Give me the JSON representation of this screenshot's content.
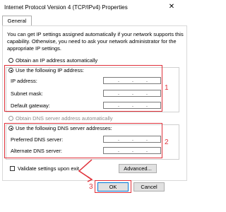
{
  "window": {
    "title": "Internet Protocol Version 4 (TCP/IPv4) Properties",
    "close_glyph": "✕"
  },
  "tabs": [
    {
      "label": "General"
    }
  ],
  "description": "You can get IP settings assigned automatically if your network supports this capability. Otherwise, you need to ask your network administrator for the appropriate IP settings.",
  "ip": {
    "auto_label": "Obtain an IP address automatically",
    "manual_label": "Use the following IP address:",
    "fields": [
      {
        "label": "IP address:"
      },
      {
        "label": "Subnet mask:"
      },
      {
        "label": "Default gateway:"
      }
    ]
  },
  "dns": {
    "auto_label": "Obtain DNS server address automatically",
    "manual_label": "Use the following DNS server addresses:",
    "fields": [
      {
        "label": "Preferred DNS server:"
      },
      {
        "label": "Alternate DNS server:"
      }
    ]
  },
  "validate_label": "Validate settings upon exit",
  "buttons": {
    "advanced": "Advanced...",
    "ok": "OK",
    "cancel": "Cancel"
  },
  "annotations": {
    "one": "1",
    "two": "2",
    "three": "3"
  },
  "colors": {
    "highlight": "#e0313a",
    "default_button_border": "#0078d7"
  }
}
